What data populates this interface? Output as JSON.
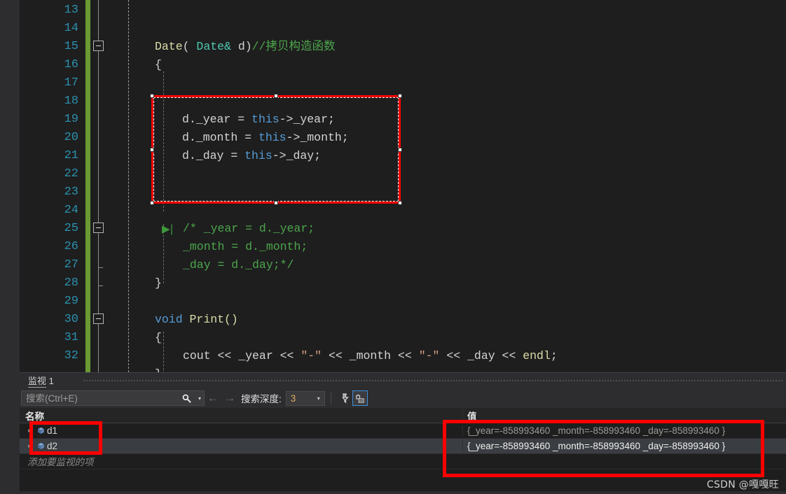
{
  "editor": {
    "first_line": 13,
    "line_numbers": [
      13,
      14,
      15,
      16,
      17,
      18,
      19,
      20,
      21,
      22,
      23,
      24,
      25,
      26,
      27,
      28,
      29,
      30,
      31,
      32
    ],
    "code_lines": [
      {
        "line": 15,
        "text": "Date( Date& d)//拷贝构造函数"
      },
      {
        "line": 16,
        "text": "{"
      },
      {
        "line": 19,
        "text": "d._year = this->_year;"
      },
      {
        "line": 20,
        "text": "d._month = this->_month;"
      },
      {
        "line": 21,
        "text": "d._day = this->_day;"
      },
      {
        "line": 25,
        "text": "/* _year = d._year;"
      },
      {
        "line": 26,
        "text": "_month = d._month;"
      },
      {
        "line": 27,
        "text": "_day = d._day;*/"
      },
      {
        "line": 28,
        "text": "}"
      },
      {
        "line": 30,
        "text": "void Print()"
      },
      {
        "line": 31,
        "text": "{"
      },
      {
        "line": 32,
        "text": "cout << _year << \"-\" << _month << \"-\" << _day << endl;"
      }
    ],
    "tokens": {
      "date_fn": "Date",
      "paren_open": "( ",
      "date_type": "Date&",
      "param": " d)",
      "comment_copy_ctor": "//拷贝构造函数",
      "brace_open": "{",
      "brace_close": "}",
      "obj_d": "d.",
      "field_year": "_year",
      "field_month": "_month",
      "field_day": "_day",
      "assign": " = ",
      "kw_this": "this",
      "arrow": "->",
      "semi": ";",
      "cmt_open": "/* _year = d._year;",
      "cmt_mid": "_month = d._month;",
      "cmt_close": "_day = d._day;*/",
      "kw_void": "void",
      "fn_print": " Print()",
      "cout": "cout",
      "shift": " << ",
      "dash_str": "\"-\"",
      "endl": "endl"
    },
    "step_marker_glyph": "▶|",
    "fold_lines": [
      15,
      25,
      30
    ]
  },
  "watch": {
    "tab_label_cn": "监视",
    "tab_label_num": "1",
    "toolbar": {
      "search_placeholder": "搜索(Ctrl+E)",
      "search_value": "",
      "search_icon": "search-icon",
      "dropdown_caret": "▾",
      "back_arrow": "←",
      "forward_arrow": "→",
      "depth_label": "搜索深度:",
      "depth_value": "3",
      "depth_caret": "▾",
      "filter_icon_name": "pin-filter-icon",
      "ab_icon_name": "hex-ab-icon",
      "ab_icon_text": "ab"
    },
    "columns": {
      "name": "名称",
      "value": "值"
    },
    "rows": [
      {
        "expander": "▸",
        "icon": "object-cube-icon",
        "name": "d1",
        "value": "{_year=-858993460 _month=-858993460 _day=-858993460 }",
        "selected": false,
        "dim": true
      },
      {
        "expander": "▸",
        "icon": "object-cube-icon",
        "name": "d2",
        "value": "{_year=-858993460 _month=-858993460 _day=-858993460 }",
        "selected": true,
        "dim": false
      }
    ],
    "add_placeholder": "添加要监视的项"
  },
  "watermark": "CSDN @嘎嘎旺",
  "colors": {
    "annotation_red": "#ff0000",
    "editor_bg": "#1e1e1e",
    "chrome_bg": "#2d2d30",
    "linenum": "#2b91af",
    "comment_green": "#4ca54c",
    "type_teal": "#4ec9b0",
    "keyword_blue": "#569cd6",
    "function_yellow": "#dcdcaa",
    "string_salmon": "#d69d85",
    "changebar_green": "#6a9a35",
    "selection_blue": "#3a3d41",
    "accent_blue": "#3f8fd8"
  }
}
